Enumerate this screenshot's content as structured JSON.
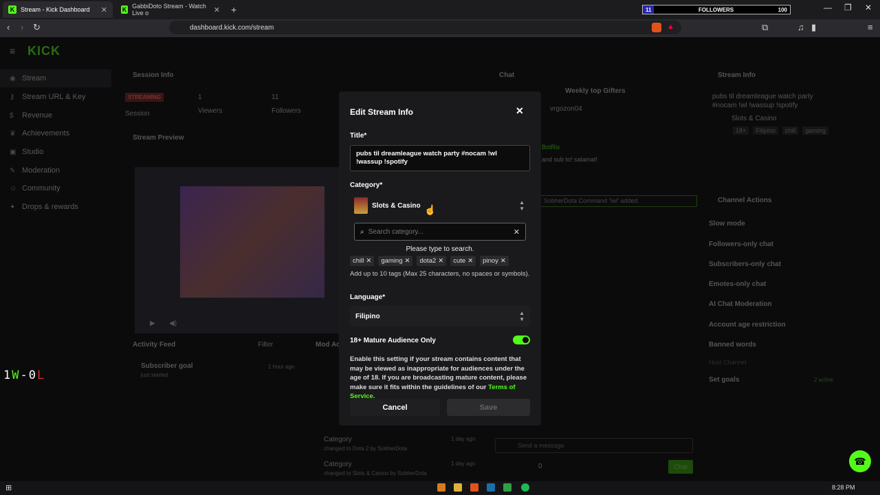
{
  "browser": {
    "tabs": [
      {
        "label": "Stream - Kick Dashboard",
        "active": true
      },
      {
        "label": "GabbiDoto Stream - Watch Live o",
        "active": false
      }
    ],
    "url": "dashboard.kick.com/stream",
    "followers_overlay": {
      "count": "11",
      "label": "FOLLOWERS",
      "goal": "100"
    }
  },
  "sidebar": {
    "logo": "KICK",
    "items": [
      {
        "label": "Stream",
        "icon": "radio-icon"
      },
      {
        "label": "Stream URL & Key",
        "icon": "key-icon"
      },
      {
        "label": "Revenue",
        "icon": "dollar-icon"
      },
      {
        "label": "Achievements",
        "icon": "trophy-icon"
      },
      {
        "label": "Studio",
        "icon": "studio-icon"
      },
      {
        "label": "Moderation",
        "icon": "wrench-icon"
      },
      {
        "label": "Community",
        "icon": "people-icon"
      },
      {
        "label": "Drops & rewards",
        "icon": "gift-icon"
      }
    ]
  },
  "background": {
    "session_info": {
      "title": "Session Info",
      "status": "STREAMING",
      "session": "Session",
      "viewers": "1",
      "viewers_label": "Viewers",
      "followers": "11",
      "followers_label": "Followers"
    },
    "stream_preview": "Stream Preview",
    "activity_feed": {
      "title": "Activity Feed",
      "filter": "Filter",
      "item": "Subscriber goal",
      "item_sub": "just started",
      "time": "1 hour ago"
    },
    "mod_actions": {
      "title": "Mod Ac",
      "items": [
        {
          "title": "Category",
          "detail": "changed to Dota 2 by SobherDota",
          "time": "1 day ago"
        },
        {
          "title": "Category",
          "detail": "changed to Slots & Casino by SobherDota",
          "time": "1 day ago"
        }
      ]
    },
    "chat": {
      "title": "Chat",
      "top_gifters": "Weekly top Gifters",
      "gifter": "vrgozon04",
      "bot": "BotRix",
      "message": "and sub to! salamat!",
      "command": "SobherDota Command '!wl' added.",
      "input_placeholder": "Send a message",
      "chat_btn": "Chat",
      "count": "0"
    },
    "stream_info": {
      "title": "Stream Info",
      "stream_title": "pubs til dreamleague watch party #nocam !wl !wassup !spotify",
      "category": "Slots & Casino",
      "tags": [
        "18+",
        "Filipino",
        "chill",
        "gaming"
      ]
    },
    "channel_actions": {
      "title": "Channel Actions",
      "items": [
        "Slow mode",
        "Followers-only chat",
        "Subscribers-only chat",
        "Emotes-only chat",
        "AI Chat Moderation",
        "Account age restriction",
        "Banned words",
        "Host Channel",
        "Set goals"
      ],
      "goals_badge": "2 active"
    },
    "score": {
      "w": "1",
      "w_letter": "W",
      "dash": "-",
      "l": "0",
      "l_letter": "L"
    }
  },
  "modal": {
    "title": "Edit Stream Info",
    "title_label": "Title*",
    "title_value": "pubs til dreamleague watch party #nocam !wl !wassup !spotify",
    "category_label": "Category*",
    "category_value": "Slots & Casino",
    "search_placeholder": "Search category...",
    "search_hint": "Please type to search.",
    "tags": [
      "chill",
      "gaming",
      "dota2",
      "cute",
      "pinoy"
    ],
    "tags_help": "Add up to 10 tags (Max 25 characters, no spaces or symbols).",
    "language_label": "Language*",
    "language_value": "Filipino",
    "mature_label": "18+ Mature Audience Only",
    "mature_enabled": true,
    "mature_desc": "Enable this setting if your stream contains content that may be viewed as inappropriate for audiences under the age of 18. If you are broadcasting mature content, please make sure it fits within the guidelines of our ",
    "mature_link": "Terms of Service.",
    "cancel_label": "Cancel",
    "save_label": "Save"
  },
  "taskbar": {
    "time": "8:28 PM"
  },
  "colors": {
    "accent": "#53fc18",
    "modal_bg": "#1a1a1c",
    "page_bg": "#0e0e10"
  }
}
